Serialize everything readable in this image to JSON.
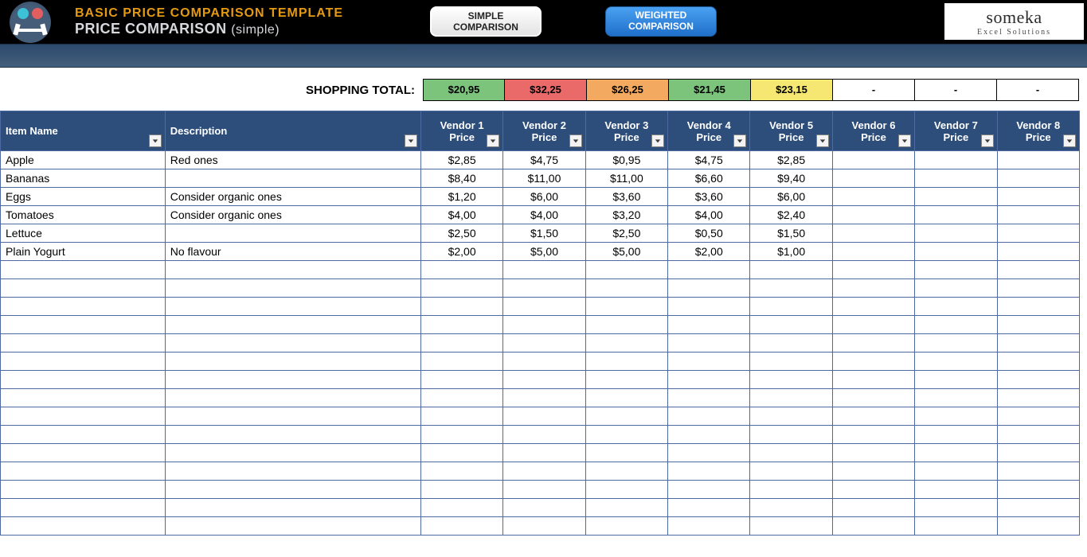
{
  "header": {
    "title_top": "BASIC PRICE COMPARISON TEMPLATE",
    "title_bottom": "PRICE COMPARISON",
    "title_parenthetical": "(simple)",
    "tab_simple_line1": "SIMPLE",
    "tab_simple_line2": "COMPARISON",
    "tab_weighted_line1": "WEIGHTED",
    "tab_weighted_line2": "COMPARISON",
    "brand_main": "someka",
    "brand_sub": "Excel Solutions"
  },
  "totals": {
    "label": "SHOPPING TOTAL:",
    "cells": [
      {
        "val": "$20,95",
        "colorClass": "c-green"
      },
      {
        "val": "$32,25",
        "colorClass": "c-red"
      },
      {
        "val": "$26,25",
        "colorClass": "c-orange"
      },
      {
        "val": "$21,45",
        "colorClass": "c-green"
      },
      {
        "val": "$23,15",
        "colorClass": "c-yellow"
      },
      {
        "val": "-",
        "colorClass": "c-empty"
      },
      {
        "val": "-",
        "colorClass": "c-empty"
      },
      {
        "val": "-",
        "colorClass": "c-empty"
      }
    ]
  },
  "columns": {
    "item": "Item Name",
    "desc": "Description",
    "price_word": "Price",
    "vendors": [
      "Vendor 1",
      "Vendor 2",
      "Vendor 3",
      "Vendor 4",
      "Vendor 5",
      "Vendor 6",
      "Vendor 7",
      "Vendor 8"
    ]
  },
  "rows": [
    {
      "item": "Apple",
      "desc": "Red ones",
      "p": [
        "$2,85",
        "$4,75",
        "$0,95",
        "$4,75",
        "$2,85",
        "",
        "",
        ""
      ]
    },
    {
      "item": "Bananas",
      "desc": "",
      "p": [
        "$8,40",
        "$11,00",
        "$11,00",
        "$6,60",
        "$9,40",
        "",
        "",
        ""
      ]
    },
    {
      "item": "Eggs",
      "desc": "Consider organic ones",
      "p": [
        "$1,20",
        "$6,00",
        "$3,60",
        "$3,60",
        "$6,00",
        "",
        "",
        ""
      ]
    },
    {
      "item": "Tomatoes",
      "desc": "Consider organic ones",
      "p": [
        "$4,00",
        "$4,00",
        "$3,20",
        "$4,00",
        "$2,40",
        "",
        "",
        ""
      ]
    },
    {
      "item": "Lettuce",
      "desc": "",
      "p": [
        "$2,50",
        "$1,50",
        "$2,50",
        "$0,50",
        "$1,50",
        "",
        "",
        ""
      ]
    },
    {
      "item": "Plain Yogurt",
      "desc": "No flavour",
      "p": [
        "$2,00",
        "$5,00",
        "$5,00",
        "$2,00",
        "$1,00",
        "",
        "",
        ""
      ]
    }
  ],
  "empty_row_count": 15
}
